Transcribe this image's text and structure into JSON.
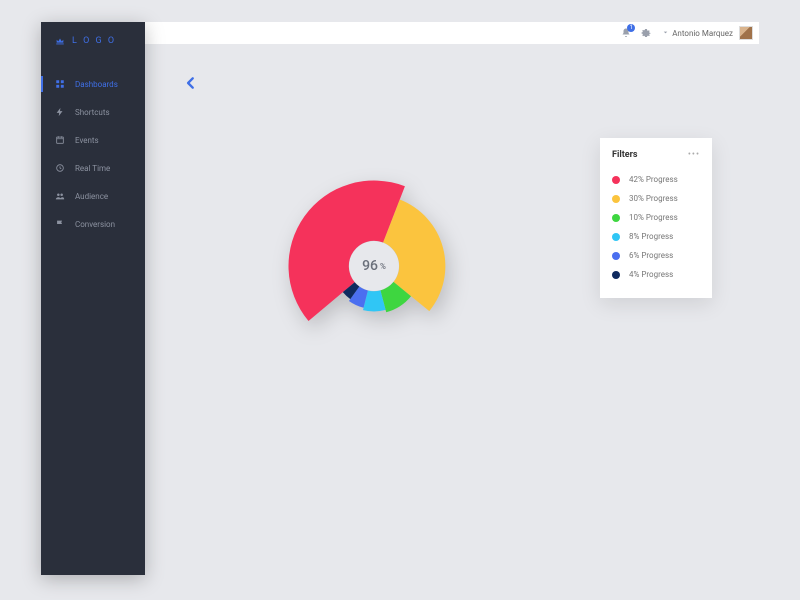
{
  "brand": {
    "name": "L O G O"
  },
  "sidebar": {
    "items": [
      {
        "label": "Dashboards",
        "icon": "grid-icon",
        "active": true
      },
      {
        "label": "Shortcuts",
        "icon": "bolt-icon"
      },
      {
        "label": "Events",
        "icon": "calendar-icon"
      },
      {
        "label": "Real Time",
        "icon": "clock-icon"
      },
      {
        "label": "Audience",
        "icon": "people-icon"
      },
      {
        "label": "Conversion",
        "icon": "flag-icon"
      }
    ]
  },
  "topbar": {
    "notification_count": "1",
    "user_name": "Antonio Marquez"
  },
  "center": {
    "value": "96",
    "unit": "%"
  },
  "filters_title": "Filters",
  "legend": [
    {
      "label": "42% Progress",
      "color": "#f5325b"
    },
    {
      "label": "30% Progress",
      "color": "#fbc43e"
    },
    {
      "label": "10% Progress",
      "color": "#3ed640"
    },
    {
      "label": "8% Progress",
      "color": "#30c6f5"
    },
    {
      "label": "6% Progress",
      "color": "#4b6ff0"
    },
    {
      "label": "4% Progress",
      "color": "#0f2a5f"
    }
  ],
  "chart_data": {
    "type": "pie",
    "title": "",
    "center_label": "96 %",
    "series": [
      {
        "name": "42% Progress",
        "value": 42,
        "color": "#f5325b"
      },
      {
        "name": "30% Progress",
        "value": 30,
        "color": "#fbc43e"
      },
      {
        "name": "10% Progress",
        "value": 10,
        "color": "#3ed640"
      },
      {
        "name": "8% Progress",
        "value": 8,
        "color": "#30c6f5"
      },
      {
        "name": "6% Progress",
        "value": 6,
        "color": "#4b6ff0"
      },
      {
        "name": "4% Progress",
        "value": 4,
        "color": "#0f2a5f"
      }
    ],
    "variable_radius": true,
    "inner_radius_pct": 28
  }
}
